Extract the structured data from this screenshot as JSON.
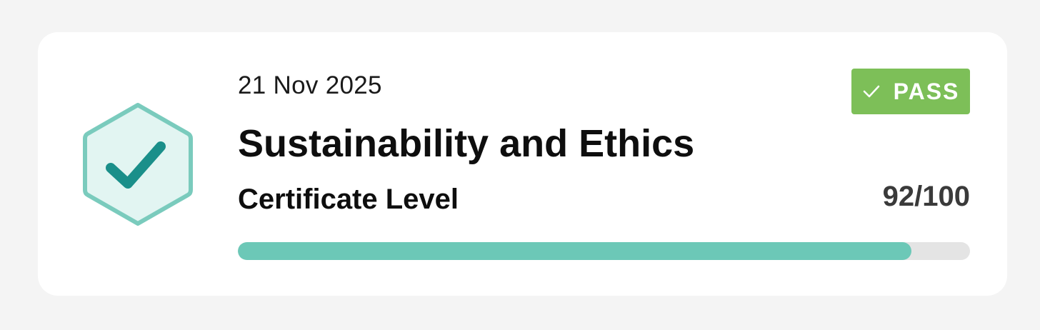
{
  "result": {
    "date": "21 Nov 2025",
    "status_label": "PASS",
    "title": "Sustainability and Ethics",
    "level": "Certificate Level",
    "score_text": "92/100",
    "score": 92,
    "max_score": 100
  },
  "icons": {
    "badge": "hexagon-check-icon",
    "status": "check-icon"
  },
  "colors": {
    "pass": "#7dbf58",
    "progress": "#6cc8b7",
    "track": "#e4e4e4",
    "badge_fill": "#e2f5f2",
    "badge_stroke": "#7acbbd",
    "badge_check": "#1a8f8a"
  }
}
